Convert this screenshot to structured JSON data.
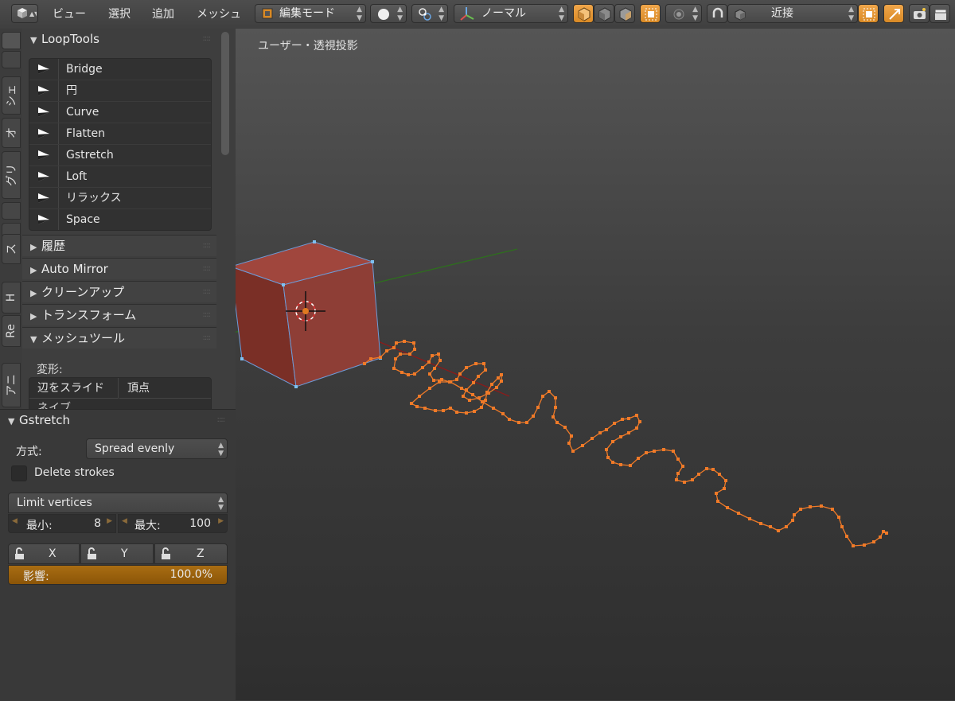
{
  "header": {
    "menus": [
      "ビュー",
      "選択",
      "追加",
      "メッシュ"
    ],
    "mode": "編集モード",
    "orientation": "ノーマル",
    "snap_target": "近接"
  },
  "left_tabs": [
    "シェ",
    "オ",
    "グリ",
    "ス",
    "H",
    "Re",
    "アニ"
  ],
  "looptools": {
    "title": "LoopTools",
    "buttons": [
      "Bridge",
      "円",
      "Curve",
      "Flatten",
      "Gstretch",
      "Loft",
      "リラックス",
      "Space"
    ]
  },
  "collapsed_panels": [
    "履歴",
    "Auto Mirror",
    "クリーンアップ",
    "トランスフォーム"
  ],
  "mesh_tools": {
    "title": "メッシュツール",
    "section_label": "変形:",
    "buttons": [
      "辺をスライド",
      "頂点"
    ],
    "partial_label": "ネイブ"
  },
  "operator": {
    "title": "Gstretch",
    "method_label": "方式:",
    "method_value": "Spread evenly",
    "delete_strokes_label": "Delete strokes",
    "delete_strokes": false,
    "limit_label": "Limit vertices",
    "min_label": "最小:",
    "min_value": "8",
    "max_label": "最大:",
    "max_value": "100",
    "axes": [
      "X",
      "Y",
      "Z"
    ],
    "influence_label": "影響:",
    "influence_value": "100.0%",
    "influence_fraction": 1.0
  },
  "viewport": {
    "label": "ユーザー・透視投影"
  },
  "colors": {
    "accent_orange": "#d9892a",
    "stroke_orange": "#f07a28",
    "cube_face": "#8e3e36",
    "axis_x": "#8c1a1a",
    "axis_y": "#2e6e1e"
  }
}
